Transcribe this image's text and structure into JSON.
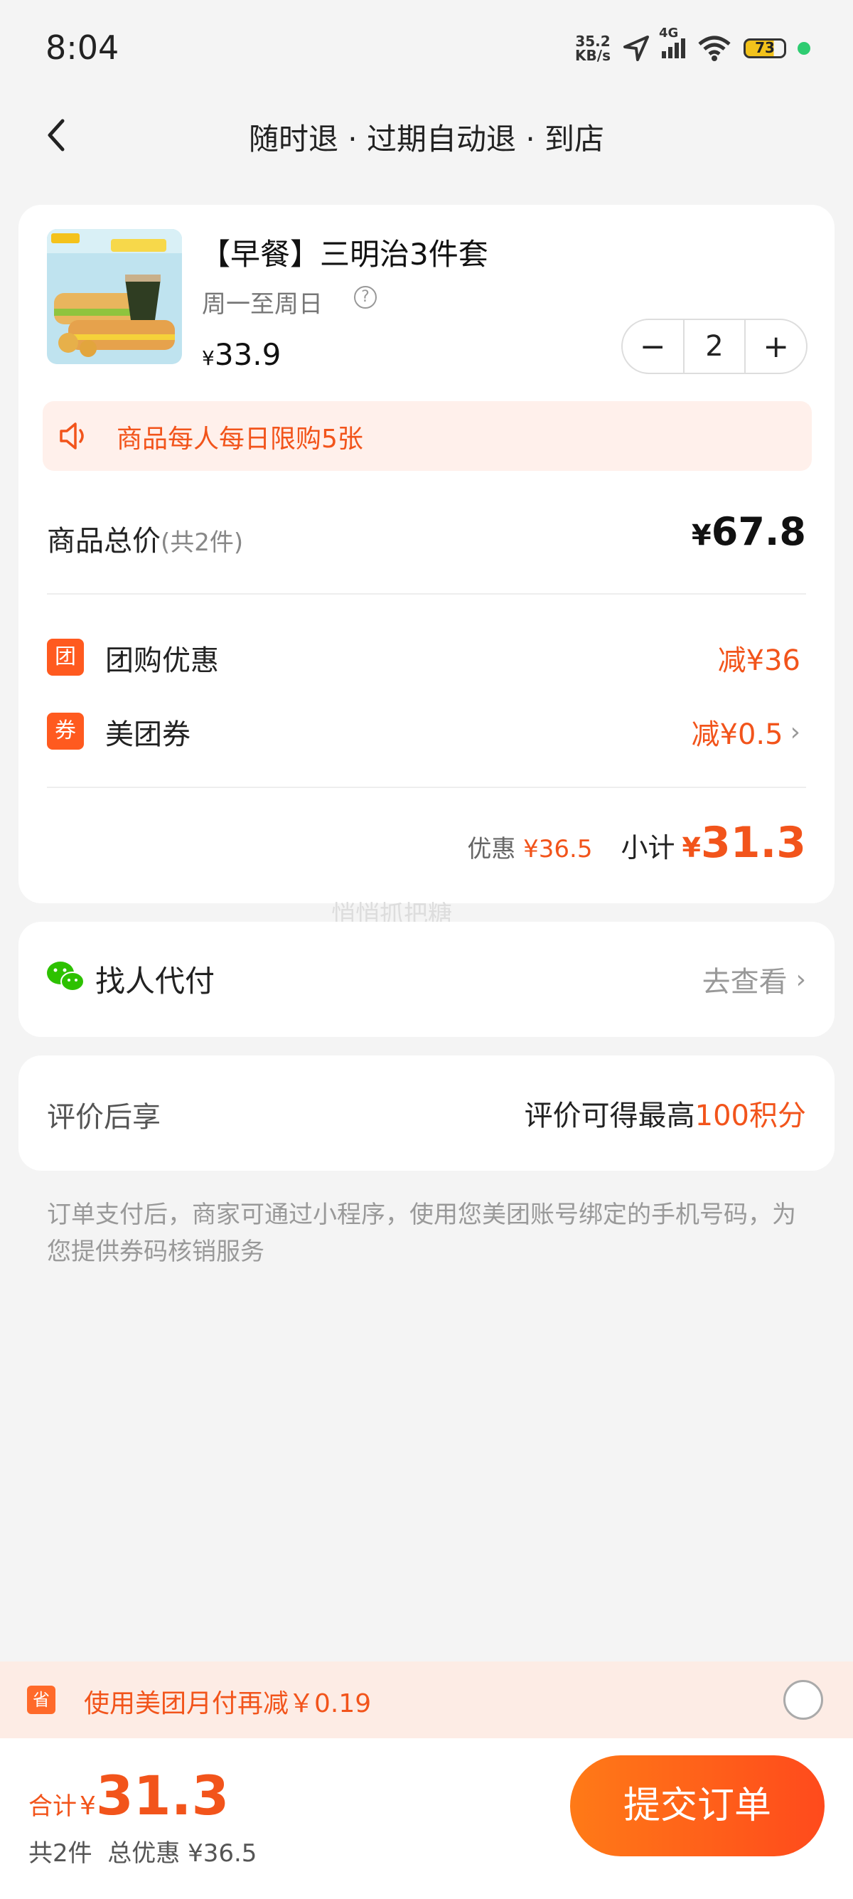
{
  "status_bar": {
    "time": "8:04",
    "net_speed_value": "35.2",
    "net_speed_unit": "KB/s",
    "network": "4G",
    "battery": "73"
  },
  "nav": {
    "title": "随时退 · 过期自动退 · 到店"
  },
  "product": {
    "title": "【早餐】三明治3件套",
    "valid_days": "周一至周日",
    "currency": "¥",
    "price": "33.9",
    "quantity": "2",
    "limit_notice": "商品每人每日限购5张"
  },
  "summary": {
    "total_label": "商品总价",
    "total_count": "(共2件)",
    "total_currency": "¥",
    "total_value": "67.8",
    "group_discount_icon": "团",
    "group_discount_label": "团购优惠",
    "group_discount_value": "减¥36",
    "coupon_icon": "券",
    "coupon_label": "美团券",
    "coupon_value": "减¥0.5",
    "saving_label": "优惠",
    "saving_value": "¥36.5",
    "subtotal_label": "小计",
    "subtotal_currency": "¥",
    "subtotal_value": "31.3"
  },
  "watermark": "悄悄抓把糖",
  "pay_for_me": {
    "label": "找人代付",
    "action": "去查看"
  },
  "review": {
    "label": "评价后享",
    "reward_prefix": "评价可得最高",
    "reward_value": "100积分"
  },
  "note": "订单支付后，商家可通过小程序，使用您美团账号绑定的手机号码，为您提供券码核销服务",
  "monthly_pay": {
    "icon": "省",
    "text": "使用美团月付再减￥0.19"
  },
  "bottom": {
    "total_label": "合计",
    "total_currency": "¥",
    "total_value": "31.3",
    "count_text": "共2件",
    "discount_text": "总优惠 ¥36.5",
    "submit_label": "提交订单"
  },
  "colors": {
    "accent": "#f2541b",
    "button_start": "#ff7a17",
    "button_end": "#ff4a1c",
    "background": "#f4f4f4"
  }
}
